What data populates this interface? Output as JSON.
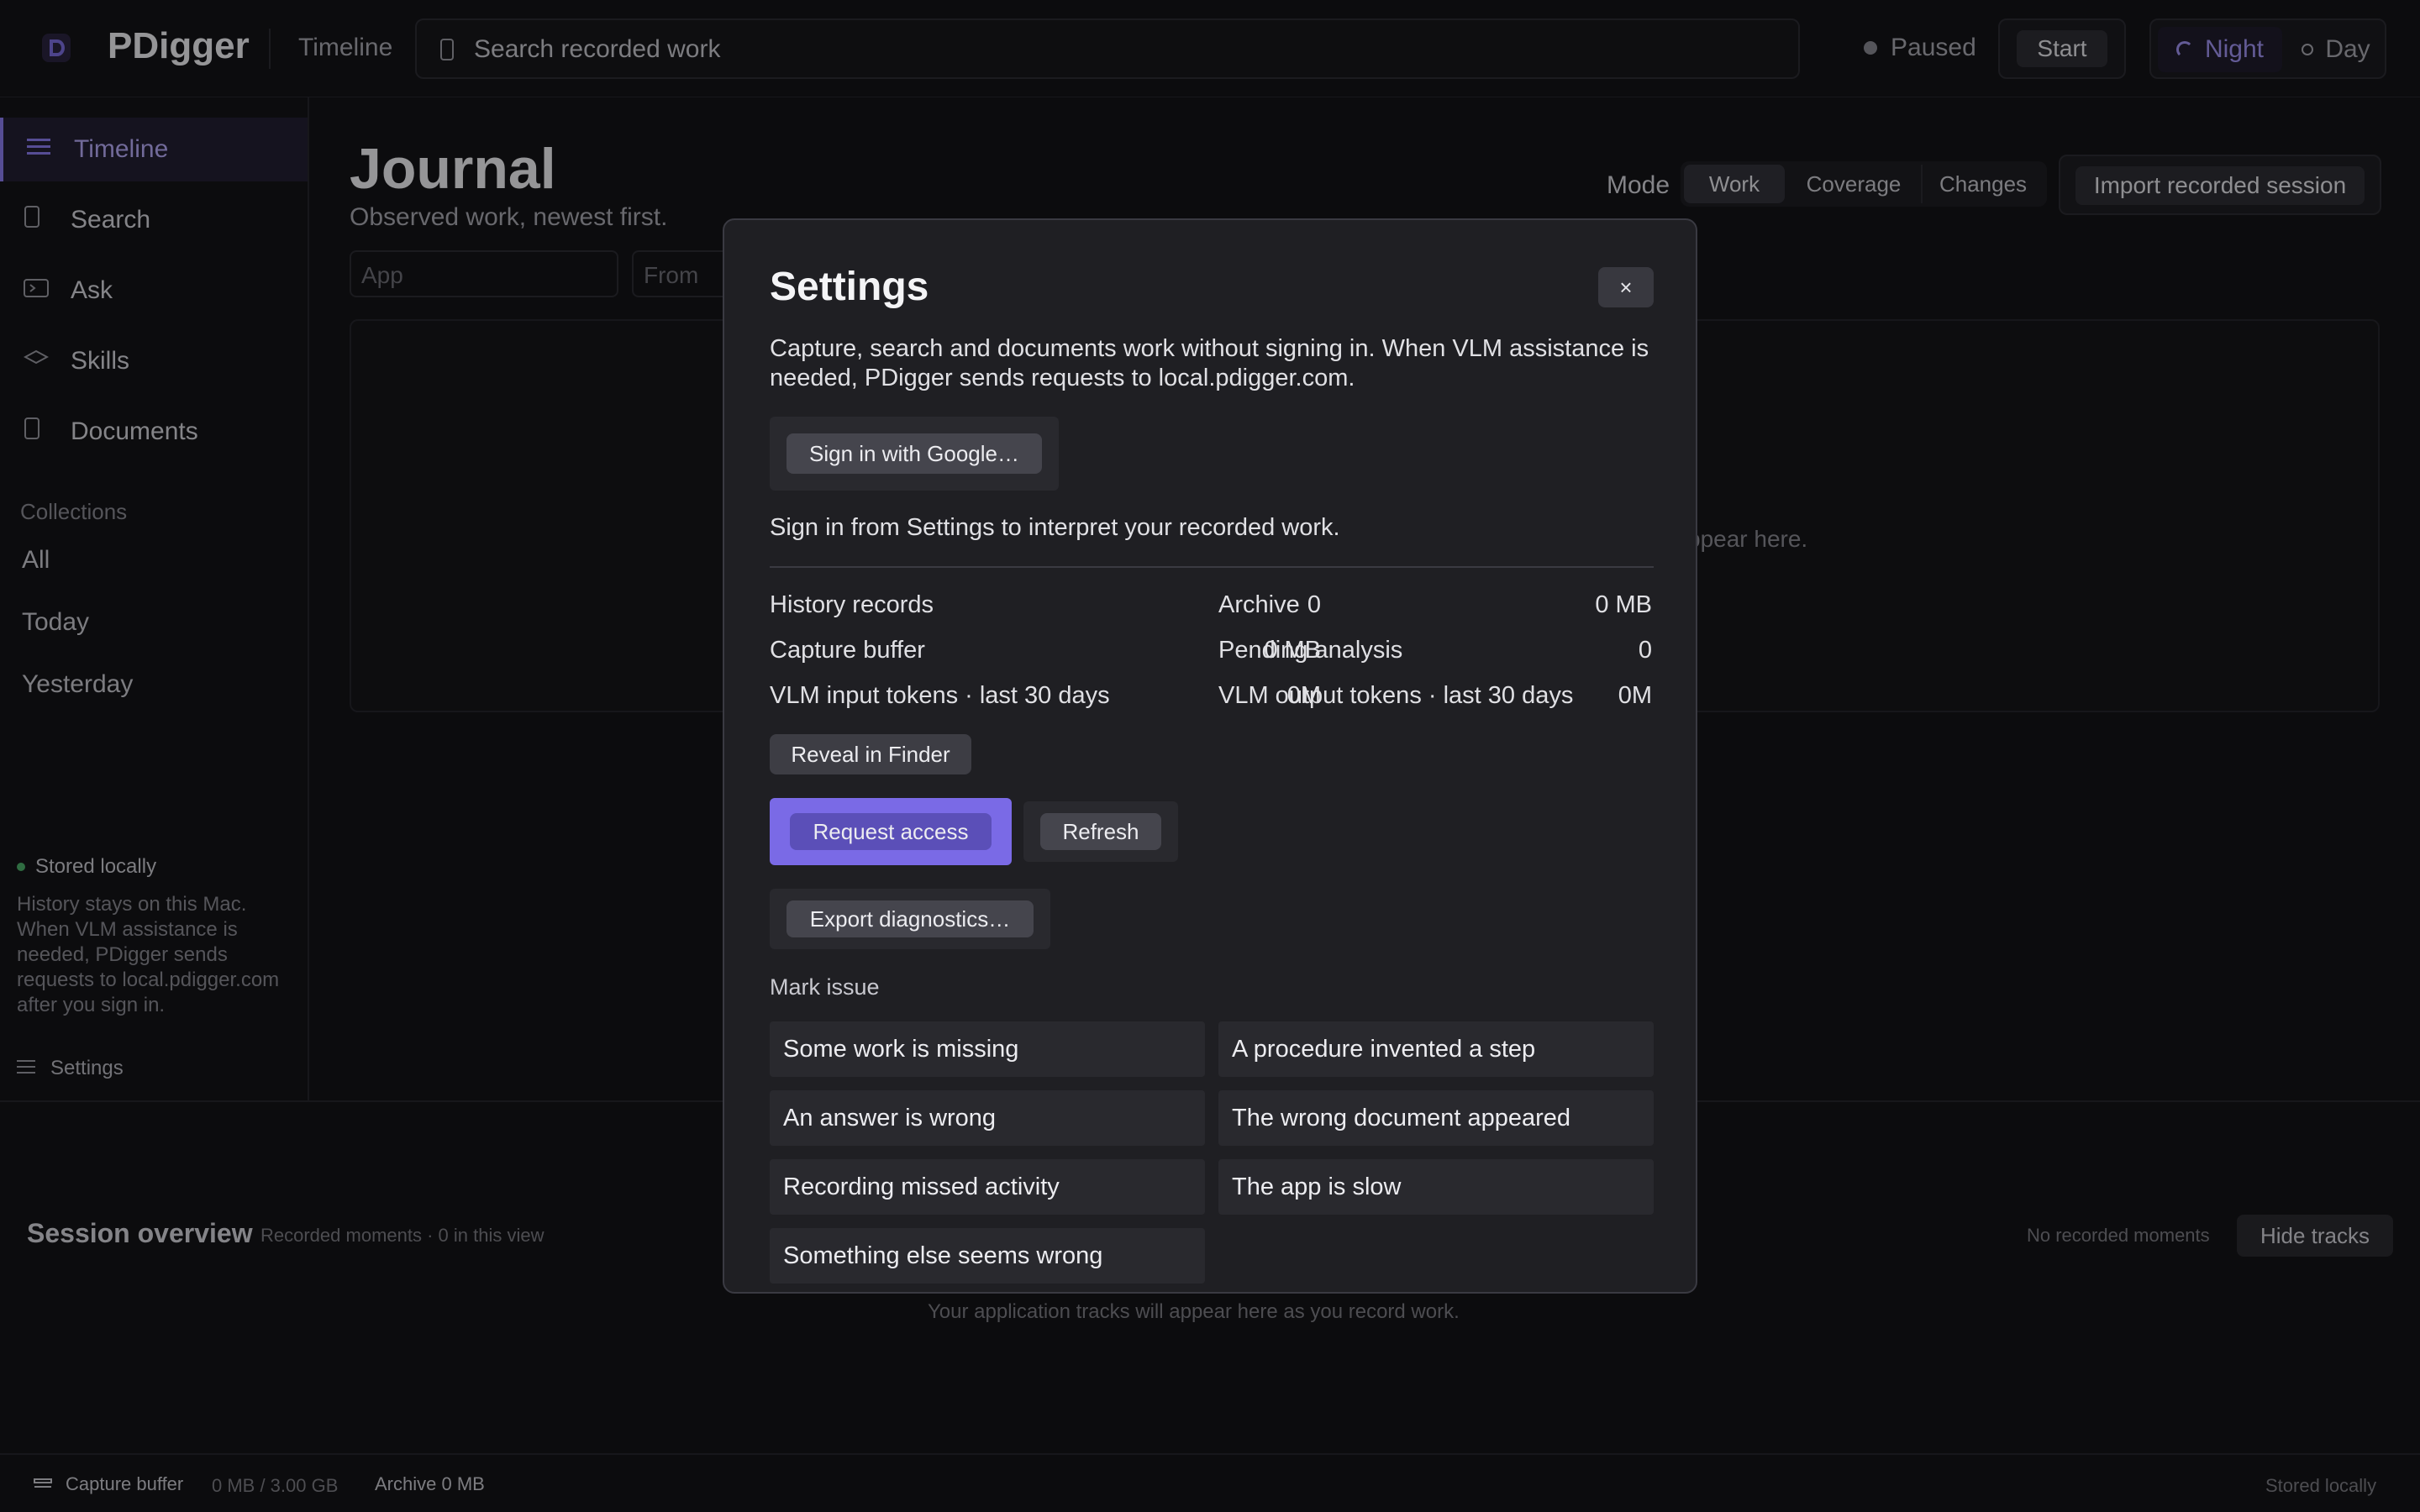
{
  "app": {
    "name": "PDigger",
    "section": "Timeline"
  },
  "topbar": {
    "search_placeholder": "Search recorded work",
    "status": "Paused",
    "start_label": "Start",
    "theme": {
      "night": "Night",
      "day": "Day"
    }
  },
  "sidebar": {
    "items": [
      {
        "label": "Timeline",
        "icon": "list-icon"
      },
      {
        "label": "Search",
        "icon": "search-icon"
      },
      {
        "label": "Ask",
        "icon": "terminal-icon"
      },
      {
        "label": "Skills",
        "icon": "diamond-icon"
      },
      {
        "label": "Documents",
        "icon": "document-icon"
      }
    ],
    "collections_title": "Collections",
    "collections": [
      "All",
      "Today",
      "Yesterday"
    ],
    "stored_label": "Stored locally",
    "history_note": "History stays on this Mac. When VLM assistance is needed, PDigger sends requests to local.pdigger.com after you sign in.",
    "settings_label": "Settings"
  },
  "main": {
    "title": "Journal",
    "subtitle": "Observed work, newest first.",
    "mode_label": "Mode",
    "modes": [
      "Work",
      "Coverage",
      "Changes"
    ],
    "import_label": "Import recorded session",
    "filter_app_placeholder": "App",
    "filter_from_placeholder": "From",
    "empty_text_fragment": "ppear here."
  },
  "session": {
    "title": "Session overview",
    "meta": "Recorded moments · 0 in this view",
    "no_moments": "No recorded moments",
    "hide_tracks": "Hide tracks",
    "empty": "Your application tracks will appear here as you record work."
  },
  "statusbar": {
    "capture_label": "Capture buffer",
    "capture_value": "0 MB / 3.00 GB",
    "archive": "Archive 0 MB",
    "stored": "Stored locally"
  },
  "settings_modal": {
    "title": "Settings",
    "close_label": "×",
    "description": "Capture, search and documents work without signing in. When VLM assistance is needed, PDigger sends requests to local.pdigger.com.",
    "sign_in_label": "Sign in with Google…",
    "sign_in_note": "Sign in from Settings to interpret your recorded work.",
    "stats": {
      "history_records": {
        "label": "History records",
        "value": "0"
      },
      "archive": {
        "label": "Archive",
        "value": "0 MB"
      },
      "capture_buffer": {
        "label": "Capture buffer",
        "value": "0 MB"
      },
      "pending_analysis": {
        "label": "Pending analysis",
        "value": "0"
      },
      "vlm_input": {
        "label": "VLM input tokens · last 30 days",
        "value": "0M"
      },
      "vlm_output": {
        "label": "VLM output tokens · last 30 days",
        "value": "0M"
      }
    },
    "reveal_label": "Reveal in Finder",
    "request_access_label": "Request access",
    "refresh_label": "Refresh",
    "export_label": "Export diagnostics…",
    "mark_issue_title": "Mark issue",
    "issues": [
      "Some work is missing",
      "A procedure invented a step",
      "An answer is wrong",
      "The wrong document appeared",
      "Recording missed activity",
      "The app is slow",
      "Something else seems wrong"
    ]
  },
  "colors": {
    "accent": "#8b7cf0",
    "background": "#141417",
    "modal": "#1f1f23"
  }
}
